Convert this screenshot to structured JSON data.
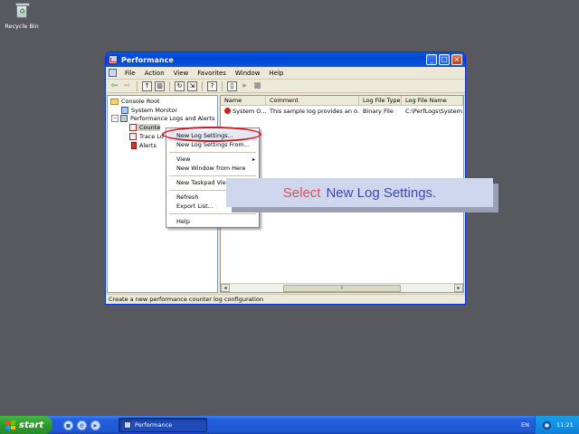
{
  "desktop": {
    "recycle_bin_label": "Recycle Bin"
  },
  "window": {
    "title": "Performance",
    "menu": [
      "File",
      "Action",
      "View",
      "Favorites",
      "Window",
      "Help"
    ],
    "tree": {
      "root": "Console Root",
      "system_monitor": "System Monitor",
      "perf_logs": "Performance Logs and Alerts",
      "counter_logs": "Counte",
      "trace_logs": "Trace Lo",
      "alerts": "Alerts"
    },
    "list": {
      "columns": [
        "Name",
        "Comment",
        "Log File Type",
        "Log File Name"
      ],
      "rows": [
        {
          "name": "System O...",
          "comment": "This sample log provides an o...",
          "type": "Binary File",
          "file": "C:\\PerfLogs\\System..."
        }
      ]
    },
    "status": "Create a new performance counter log configuration"
  },
  "context_menu": {
    "items": [
      "New Log Settings...",
      "New Log Settings From...",
      "View",
      "New Window from Here",
      "New Taskpad View...",
      "Refresh",
      "Export List...",
      "Help"
    ],
    "highlighted_item": "New Log Settings..."
  },
  "callout": {
    "verb": "Select",
    "object": "New Log Settings."
  },
  "taskbar": {
    "start_label": "start",
    "task_label": "Performance",
    "language": "EN",
    "clock": "11:21"
  },
  "colors": {
    "desktop_bg": "#57595e",
    "highlight_oval": "#e0101a",
    "callout_verb": "#e0505a",
    "callout_object": "#3c4ab0"
  }
}
